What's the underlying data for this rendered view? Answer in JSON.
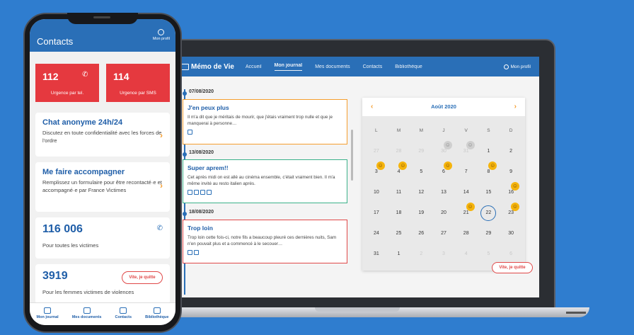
{
  "laptop": {
    "brand": "Mémo de Vie",
    "nav": [
      "Accueil",
      "Mon journal",
      "Mes documents",
      "Contacts",
      "Bibliothèque"
    ],
    "profile": "Mon profil",
    "entries": [
      {
        "date": "07/08/2020",
        "title": "J'en peux plus",
        "text": "Il m'a dit que je méritais de mourir, que j'étais vraiment trop nulle et que je manquerai à personne…",
        "color": "#f59e2f"
      },
      {
        "date": "13/08/2020",
        "title": "Super aprem!!",
        "text": "Cet après midi on est allé au cinéma ensemble, c'était vraiment bien. Il m'a même invité au resto italien après.",
        "color": "#3bb18a"
      },
      {
        "date": "18/08/2020",
        "title": "Trop loin",
        "text": "Trop loin cette fois-ci, notre fils a beaucoup pleuré ces dernières nuits, Sam n'en pouvait plus et a commencé à le secouer…",
        "color": "#e04848"
      }
    ],
    "calendar": {
      "month": "Août 2020",
      "weekdays": [
        "L",
        "M",
        "M",
        "J",
        "V",
        "S",
        "D"
      ],
      "days": [
        "27",
        "28",
        "29",
        "30",
        "31",
        "1",
        "2",
        "3",
        "4",
        "5",
        "6",
        "7",
        "8",
        "9",
        "10",
        "11",
        "12",
        "13",
        "14",
        "15",
        "16",
        "17",
        "18",
        "19",
        "20",
        "21",
        "22",
        "23",
        "24",
        "25",
        "26",
        "27",
        "28",
        "29",
        "30",
        "31",
        "1",
        "2",
        "3",
        "4",
        "5",
        "6"
      ]
    },
    "quit_label": "Vite, je quitte"
  },
  "phone": {
    "title": "Contacts",
    "profile": "Mon profil",
    "urgent_tel": {
      "num": "112",
      "label": "Urgence par tel."
    },
    "urgent_sms": {
      "num": "114",
      "label": "Urgence par SMS"
    },
    "chat": {
      "title": "Chat anonyme 24h/24",
      "desc": "Discutez en toute confidentialité avec les forces de l'ordre"
    },
    "accomp": {
      "title": "Me faire accompagner",
      "desc": "Remplissez un formulaire pour être recontacté·e et accompagné·e par France Victimes"
    },
    "victims": {
      "num": "116 006",
      "desc": "Pour toutes les victimes"
    },
    "women": {
      "num": "3919",
      "desc": "Pour les femmes victimes de violences"
    },
    "quit_label": "Vite, je quitte",
    "tabs": [
      "Mon journal",
      "Mes documents",
      "Contacts",
      "Bibliothèque"
    ]
  }
}
